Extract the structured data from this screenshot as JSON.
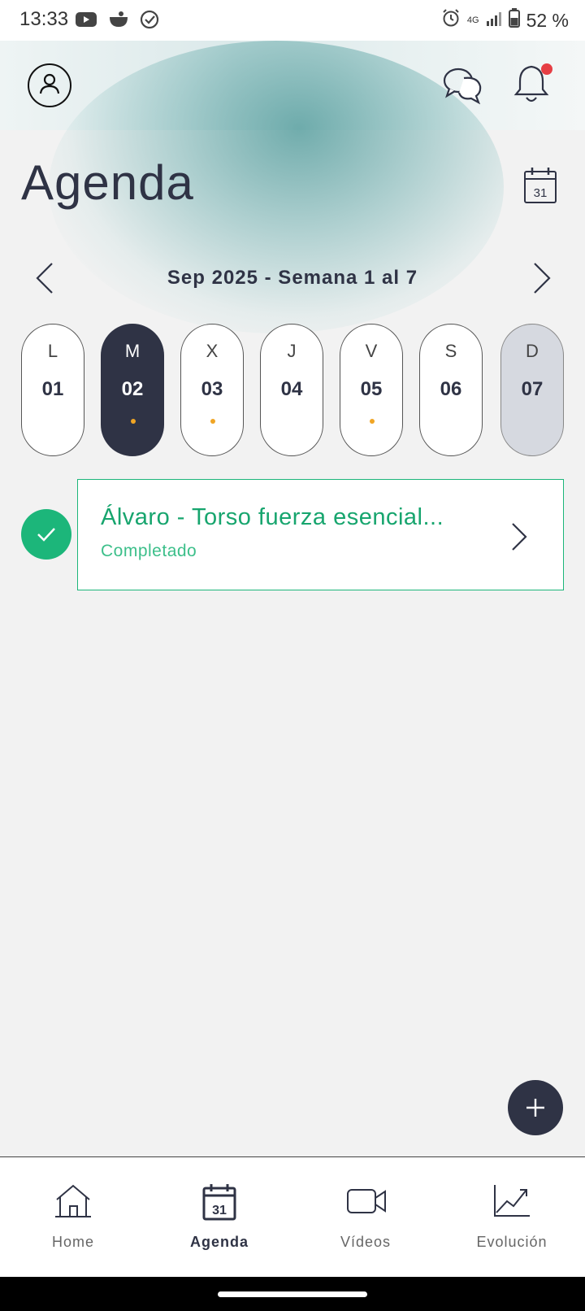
{
  "status_bar": {
    "time": "13:33",
    "battery": "52 %",
    "network": "4G",
    "icons": [
      "youtube-icon",
      "cooking-pot-icon",
      "check-circle-icon",
      "alarm-icon",
      "signal-icon",
      "battery-icon"
    ]
  },
  "header": {
    "icons": [
      "user-icon",
      "chat-icon",
      "bell-icon"
    ],
    "notification_dot_color": "#e63e44"
  },
  "page": {
    "title": "Agenda",
    "calendar_icon_day": "31"
  },
  "week_nav": {
    "label": "Sep 2025 - Semana 1 al 7"
  },
  "days": [
    {
      "letter": "L",
      "number": "01",
      "has_event": false,
      "state": "normal"
    },
    {
      "letter": "M",
      "number": "02",
      "has_event": true,
      "state": "selected"
    },
    {
      "letter": "X",
      "number": "03",
      "has_event": true,
      "state": "normal"
    },
    {
      "letter": "J",
      "number": "04",
      "has_event": false,
      "state": "normal"
    },
    {
      "letter": "V",
      "number": "05",
      "has_event": true,
      "state": "normal"
    },
    {
      "letter": "S",
      "number": "06",
      "has_event": false,
      "state": "normal"
    },
    {
      "letter": "D",
      "number": "07",
      "has_event": false,
      "state": "today"
    }
  ],
  "workouts": [
    {
      "title": "Álvaro - Torso fuerza esencial...",
      "status": "Completado"
    }
  ],
  "bottom_nav": {
    "items": [
      {
        "label": "Home",
        "icon": "home-icon",
        "active": false
      },
      {
        "label": "Agenda",
        "icon": "calendar-icon",
        "active": true,
        "icon_day": "31"
      },
      {
        "label": "Vídeos",
        "icon": "video-camera-icon",
        "active": false
      },
      {
        "label": "Evolución",
        "icon": "trend-chart-icon",
        "active": false
      }
    ]
  },
  "colors": {
    "primary_dark": "#2f3345",
    "success_green": "#1cb67a",
    "event_dot": "#f0a524",
    "today_bg": "#d6d9e0"
  }
}
